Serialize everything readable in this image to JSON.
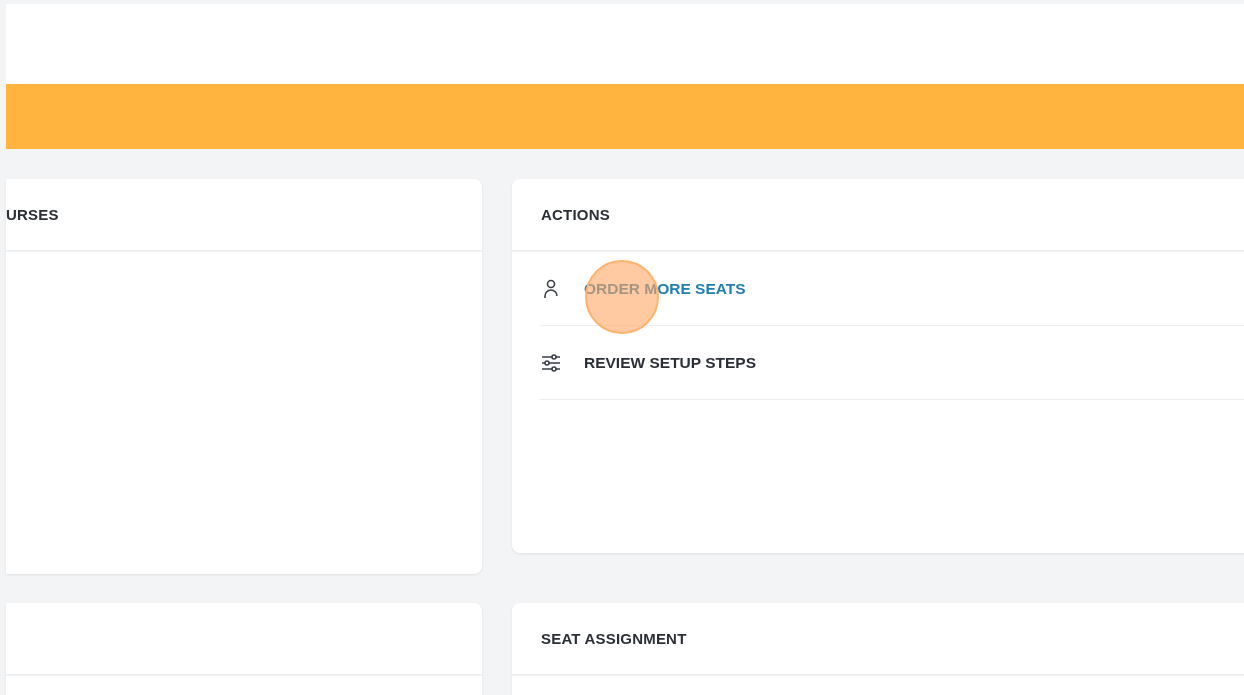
{
  "cards": [
    {
      "title": "URSES",
      "kind": "left"
    },
    {
      "title": "ACTIONS",
      "kind": "right",
      "items": [
        {
          "label": "ORDER MORE SEATS",
          "kind": "person",
          "selected": true,
          "clicked": true
        },
        {
          "label": "REVIEW SETUP STEPS",
          "kind": "sliders",
          "selected": false,
          "clicked": false
        }
      ]
    },
    {
      "title": "SEAT ASSIGNMENT",
      "kind": "right"
    }
  ]
}
